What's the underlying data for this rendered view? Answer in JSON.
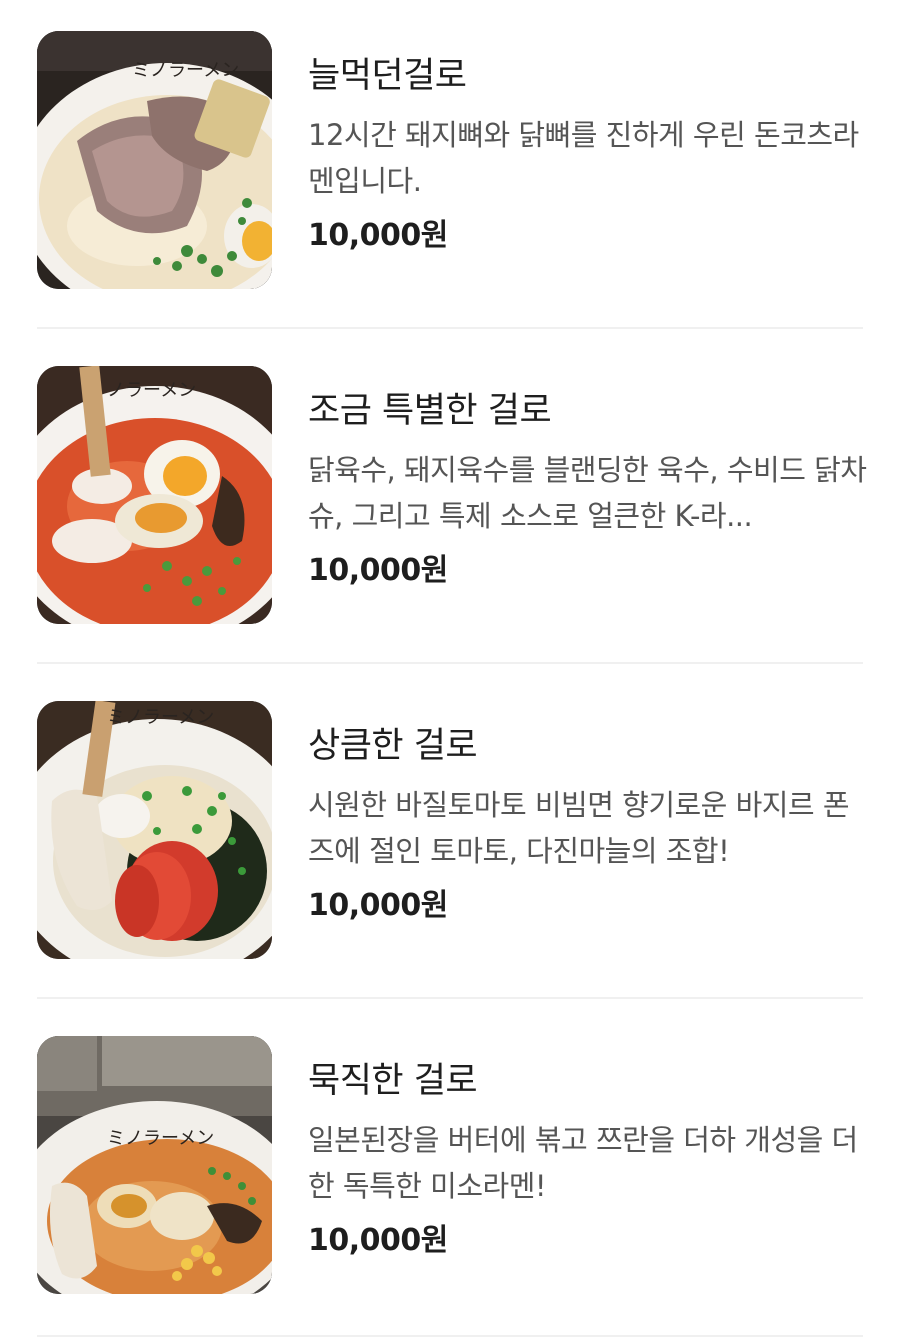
{
  "menu": {
    "items": [
      {
        "name": "늘먹던걸로",
        "description": "12시간 돼지뼈와 닭뼈를 진하게 우린 돈코츠라멘입니다.",
        "price": "10,000원",
        "bowl_text": "ミノラーメン",
        "photo": "tonkotsu-ramen-photo"
      },
      {
        "name": "조금 특별한 걸로",
        "description": "닭육수, 돼지육수를 블랜딩한 육수, 수비드 닭차슈, 그리고 특제 소스로 얼큰한 K-라...",
        "price": "10,000원",
        "bowl_text": "ノラーメン",
        "photo": "spicy-ramen-photo"
      },
      {
        "name": "상큼한 걸로",
        "description": "시원한 바질토마토 비빔면 향기로운 바지르 폰즈에 절인 토마토, 다진마늘의 조합!",
        "price": "10,000원",
        "bowl_text": "ミノラーメン",
        "photo": "tomato-mazemen-photo"
      },
      {
        "name": "묵직한 걸로",
        "description": "일본된장을 버터에 볶고 쯔란을 더하 개성을 더한 독특한 미소라멘!",
        "price": "10,000원",
        "bowl_text": "ミノラーメン",
        "photo": "miso-ramen-photo"
      }
    ]
  }
}
